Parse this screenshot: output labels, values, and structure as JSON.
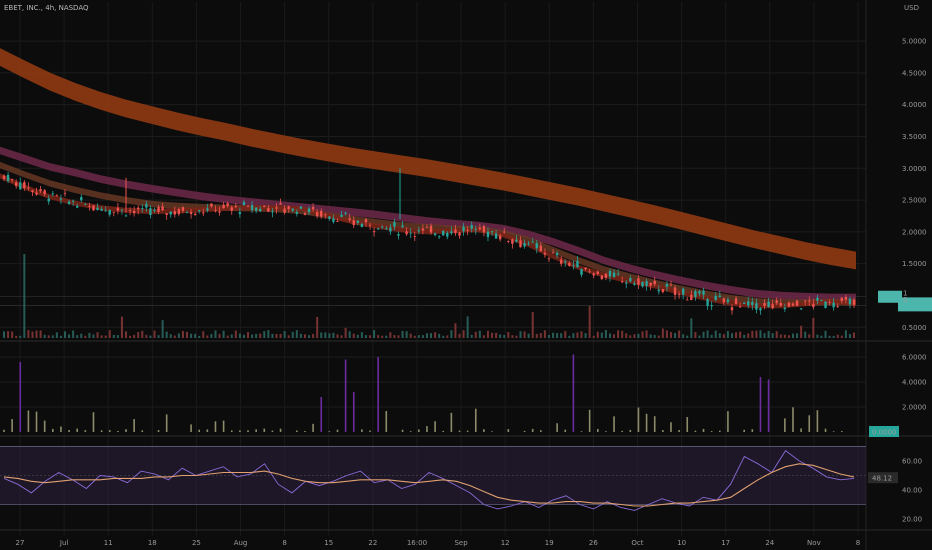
{
  "chart_data": {
    "type": "candlestick",
    "title": "EBET, INC., 4h, NASDAQ",
    "currency": "USD",
    "price_axis": {
      "ticks": [
        "5.0000",
        "4.5000",
        "4.0000",
        "3.5000",
        "3.0000",
        "2.5000",
        "2.0000",
        "1.5000",
        "0.5000"
      ],
      "ylim": [
        0.3,
        5.3
      ]
    },
    "price_labels": [
      "1",
      "0"
    ],
    "volume_axis": {
      "ticks": [
        "6.0000",
        "4.0000",
        "2.0000"
      ],
      "ylim": [
        0,
        7.2
      ],
      "last_value": "0.0000"
    },
    "oscillator_axis": {
      "ticks": [
        "60.00",
        "40.00",
        "20.00"
      ],
      "ylim": [
        18,
        73
      ],
      "bands": [
        70,
        30
      ],
      "last_value": "48.12"
    },
    "x_axis": {
      "ticks": [
        "27",
        "Jul",
        "11",
        "18",
        "25",
        "Aug",
        "8",
        "15",
        "22",
        "16:00",
        "Sep",
        "12",
        "19",
        "26",
        "Oct",
        "10",
        "17",
        "24",
        "Nov",
        "8"
      ]
    },
    "series": [
      {
        "values": [
          4.75,
          4.55,
          4.36,
          4.2,
          4.06,
          3.94,
          3.84,
          3.74,
          3.65,
          3.57,
          3.48,
          3.4,
          3.32,
          3.25,
          3.18,
          3.12,
          3.06,
          3.0,
          2.93,
          2.86,
          2.79,
          2.71,
          2.63,
          2.55,
          2.46,
          2.37,
          2.28,
          2.18,
          2.08,
          1.98,
          1.88,
          1.79,
          1.7,
          1.62,
          1.55
        ]
      },
      {
        "values": [
          3.28,
          3.15,
          3.02,
          2.93,
          2.83,
          2.75,
          2.68,
          2.62,
          2.56,
          2.51,
          2.47,
          2.43,
          2.39,
          2.35,
          2.31,
          2.27,
          2.22,
          2.17,
          2.13,
          2.1,
          2.05,
          1.96,
          1.84,
          1.7,
          1.55,
          1.43,
          1.33,
          1.24,
          1.16,
          1.09,
          1.03,
          1.0,
          0.98,
          0.97,
          0.97
        ]
      },
      {
        "values": [
          3.05,
          2.9,
          2.76,
          2.66,
          2.57,
          2.5,
          2.44,
          2.41,
          2.39,
          2.38,
          2.37,
          2.36,
          2.33,
          2.26,
          2.2,
          2.15,
          2.1,
          2.07,
          2.05,
          2.04,
          1.98,
          1.87,
          1.71,
          1.55,
          1.41,
          1.3,
          1.2,
          1.11,
          1.03,
          0.96,
          0.91,
          0.89,
          0.89,
          0.9,
          0.89
        ]
      },
      {
        "values": [
          2.88,
          2.7,
          2.55,
          2.45,
          2.38,
          2.34,
          2.32,
          2.33,
          2.35,
          2.37,
          2.38,
          2.38,
          2.36,
          2.26,
          2.16,
          2.09,
          2.03,
          2.0,
          2.02,
          2.04,
          1.95,
          1.8,
          1.61,
          1.44,
          1.32,
          1.23,
          1.15,
          1.05,
          0.96,
          0.88,
          0.84,
          0.84,
          0.87,
          0.9,
          0.88
        ]
      }
    ],
    "oscillator": {
      "raw": [
        48,
        44,
        38,
        46,
        52,
        47,
        41,
        50,
        49,
        45,
        53,
        51,
        47,
        55,
        50,
        53,
        56,
        49,
        51,
        58,
        44,
        38,
        46,
        43,
        46,
        50,
        53,
        45,
        47,
        41,
        44,
        52,
        48,
        43,
        38,
        30,
        27,
        29,
        32,
        28,
        33,
        36,
        30,
        27,
        32,
        28,
        26,
        30,
        34,
        31,
        29,
        35,
        33,
        44,
        63,
        58,
        52,
        67,
        60,
        55,
        49,
        47,
        48
      ],
      "smooth": [
        49,
        48,
        46,
        45,
        46,
        47,
        47,
        47,
        48,
        48,
        48,
        49,
        49,
        50,
        50,
        51,
        52,
        52,
        52,
        53,
        51,
        48,
        46,
        45,
        45,
        46,
        47,
        47,
        47,
        46,
        45,
        46,
        47,
        46,
        43,
        39,
        35,
        33,
        32,
        31,
        31,
        32,
        32,
        31,
        31,
        30,
        29,
        29,
        30,
        31,
        31,
        32,
        33,
        35,
        41,
        47,
        52,
        56,
        58,
        57,
        54,
        51,
        49
      ]
    }
  }
}
